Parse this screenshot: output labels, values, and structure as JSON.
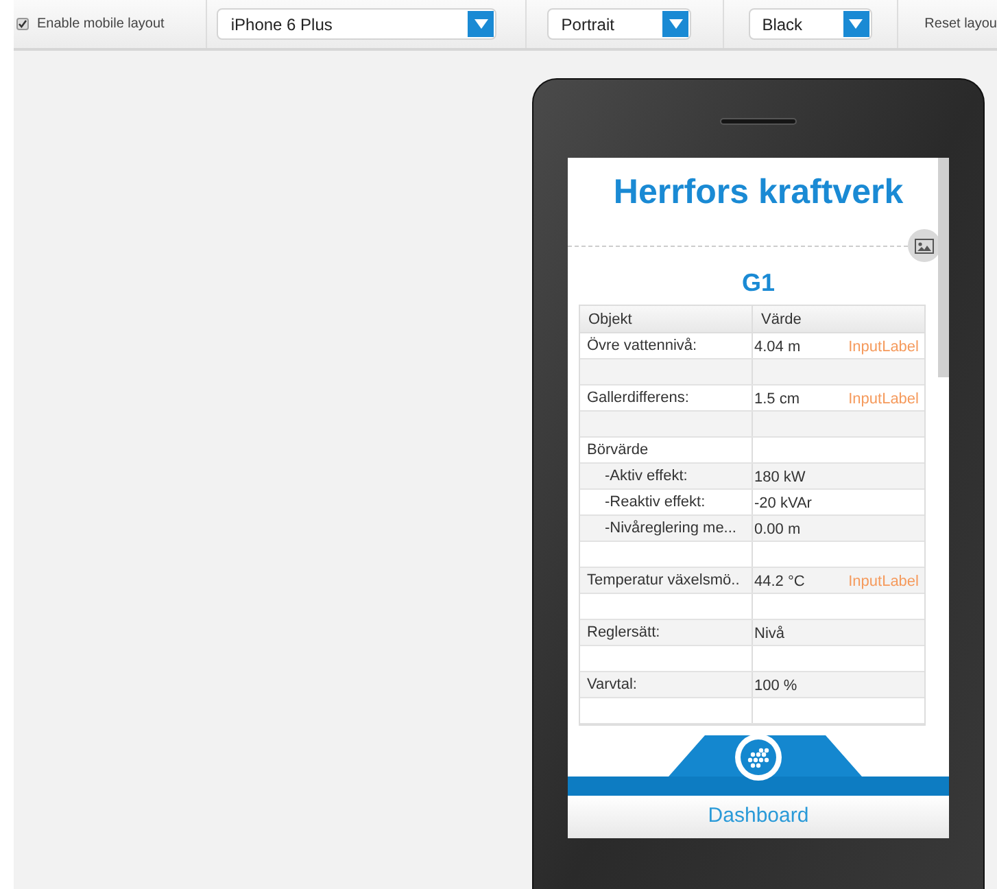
{
  "toolbar": {
    "mobile_layout": {
      "label": "Enable mobile layout",
      "checked": true
    },
    "dropdowns": [
      {
        "value": "iPhone 6 Plus"
      },
      {
        "value": "Portrait"
      },
      {
        "value": "Black"
      }
    ],
    "reset_button": "Reset layou"
  },
  "app": {
    "title": "Herrfors kraftverk",
    "section": "G1",
    "table": {
      "columns": [
        "Objekt",
        "Värde"
      ],
      "rows": [
        {
          "kind": "data",
          "label": "Övre vattennivå:",
          "value": "4.04 m",
          "tag": "InputLabel"
        },
        {
          "kind": "blank"
        },
        {
          "kind": "data",
          "label": "Gallerdifferens:",
          "value": "1.5 cm",
          "tag": "InputLabel"
        },
        {
          "kind": "blank"
        },
        {
          "kind": "data",
          "label": "Börvärde",
          "children": [
            {
              "kind": "data",
              "label": "-Aktiv effekt:",
              "value": "180 kW"
            },
            {
              "kind": "data",
              "label": "-Reaktiv effekt:",
              "value": "-20 kVAr"
            },
            {
              "kind": "data",
              "label": "-Nivåreglering me...",
              "value": "0.00 m"
            }
          ]
        },
        {
          "kind": "blank"
        },
        {
          "kind": "data",
          "label": "Temperatur växelsmö..",
          "value": "44.2 °C",
          "tag": "InputLabel"
        },
        {
          "kind": "blank"
        },
        {
          "kind": "data",
          "label": "Reglersätt:",
          "value": "Nivå"
        },
        {
          "kind": "blank"
        },
        {
          "kind": "data",
          "label": "Varvtal:",
          "value": "100 %"
        },
        {
          "kind": "blank"
        }
      ]
    },
    "nav": {
      "label": "Dashboard"
    }
  }
}
